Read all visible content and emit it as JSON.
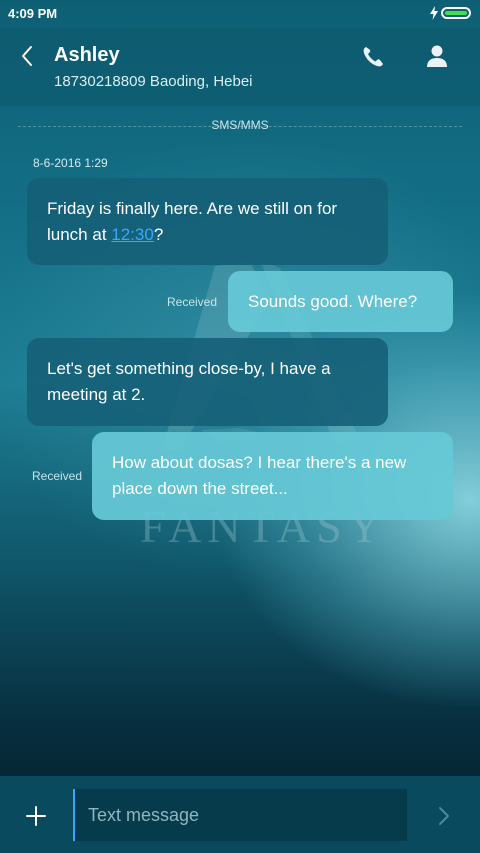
{
  "status_bar": {
    "time": "4:09 PM",
    "battery_level": 1.0,
    "battery_color": "#43e04a",
    "icons": [
      "charging-bolt-icon",
      "battery-icon"
    ]
  },
  "header": {
    "name": "Ashley",
    "subtitle": "18730218809 Baoding, Hebei",
    "icons": [
      "back-chevron-icon",
      "phone-icon",
      "contact-person-icon"
    ]
  },
  "thread": {
    "channel_label": "SMS/MMS",
    "timestamp": "8-6-2016 1:29",
    "messages": [
      {
        "direction": "incoming",
        "text_before": "Friday is finally here. Are we still on for lunch at ",
        "link": "12:30",
        "text_after": "?"
      },
      {
        "direction": "outgoing",
        "status": "Received",
        "text": "Sounds good. Where?"
      },
      {
        "direction": "incoming",
        "text": "Let's get something close-by, I have a meeting at 2."
      },
      {
        "direction": "outgoing",
        "status": "Received",
        "text": "How about dosas? I hear there's a new place down the street..."
      }
    ]
  },
  "background": {
    "watermark_text": "FANTASY"
  },
  "composer": {
    "placeholder": "Text message",
    "value": "",
    "icons": [
      "plus-icon",
      "send-chevron-icon"
    ]
  },
  "colors": {
    "accent": "#3aa7ff",
    "incoming_bubble": "#145f76",
    "outgoing_bubble": "#66c8d6",
    "input_bar": "#0a4a5e"
  }
}
